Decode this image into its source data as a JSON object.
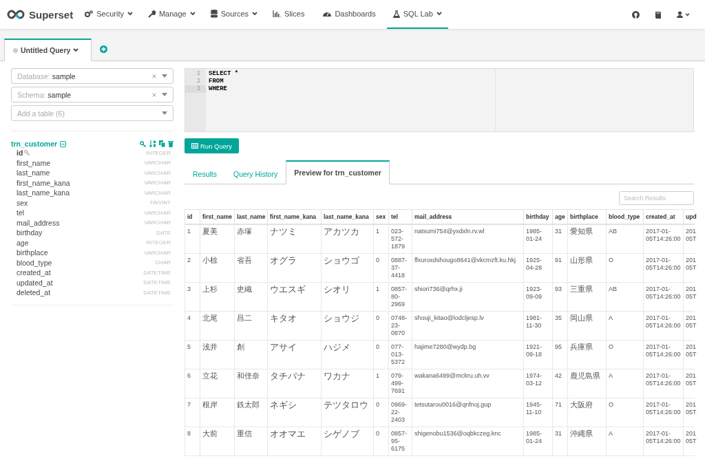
{
  "navbar": {
    "brand": "Superset",
    "items": [
      {
        "label": "Security",
        "dropdown": true,
        "selected": false
      },
      {
        "label": "Manage",
        "dropdown": true,
        "selected": false
      },
      {
        "label": "Sources",
        "dropdown": true,
        "selected": false
      },
      {
        "label": "Slices",
        "dropdown": false,
        "selected": false
      },
      {
        "label": "Dashboards",
        "dropdown": false,
        "selected": false
      },
      {
        "label": "SQL Lab",
        "dropdown": true,
        "selected": true
      }
    ]
  },
  "query_tabs": [
    {
      "label": "Untitled Query",
      "selected": true
    }
  ],
  "sidebar": {
    "database": {
      "label": "Database:",
      "value": "sample"
    },
    "schema": {
      "label": "Schema:",
      "value": "sample"
    },
    "table_select": {
      "placeholder": "Add a table (6)"
    },
    "table": {
      "name": "trn_customer",
      "expanded": true,
      "columns": [
        {
          "name": "id",
          "type": "INTEGER",
          "primary_key": true
        },
        {
          "name": "first_name",
          "type": "VARCHAR",
          "primary_key": false
        },
        {
          "name": "last_name",
          "type": "VARCHAR",
          "primary_key": false
        },
        {
          "name": "first_name_kana",
          "type": "VARCHAR",
          "primary_key": false
        },
        {
          "name": "last_name_kana",
          "type": "VARCHAR",
          "primary_key": false
        },
        {
          "name": "sex",
          "type": "TINYINT",
          "primary_key": false
        },
        {
          "name": "tel",
          "type": "VARCHAR",
          "primary_key": false
        },
        {
          "name": "mail_address",
          "type": "VARCHAR",
          "primary_key": false
        },
        {
          "name": "birthday",
          "type": "DATE",
          "primary_key": false
        },
        {
          "name": "age",
          "type": "INTEGER",
          "primary_key": false
        },
        {
          "name": "birthplace",
          "type": "VARCHAR",
          "primary_key": false
        },
        {
          "name": "blood_type",
          "type": "CHAR",
          "primary_key": false
        },
        {
          "name": "created_at",
          "type": "DATETIME",
          "primary_key": false
        },
        {
          "name": "updated_at",
          "type": "DATETIME",
          "primary_key": false
        },
        {
          "name": "deleted_at",
          "type": "DATETIME",
          "primary_key": false
        }
      ]
    }
  },
  "editor": {
    "lines": [
      {
        "number": "1",
        "text": "SELECT *",
        "active": false
      },
      {
        "number": "2",
        "text": "FROM",
        "active": false
      },
      {
        "number": "3",
        "text": "WHERE",
        "active": true
      }
    ]
  },
  "run_button": "Run Query",
  "result_tabs": [
    {
      "label": "Results",
      "selected": false
    },
    {
      "label": "Query History",
      "selected": false
    },
    {
      "label": "Preview for trn_customer",
      "selected": true
    }
  ],
  "search": {
    "placeholder": "Search Results"
  },
  "table": {
    "columns": [
      "id",
      "first_name",
      "last_name",
      "first_name_kana",
      "last_name_kana",
      "sex",
      "tel",
      "mail_address",
      "birthday",
      "age",
      "birthplace",
      "blood_type",
      "created_at",
      "upd"
    ],
    "rows": [
      [
        "1",
        "夏美",
        "赤塚",
        "ナツミ",
        "アカツカ",
        "1",
        "023-572-1879",
        "natsumi754@yxdxln.rv.wl",
        "1985-01-24",
        "31",
        "愛知県",
        "AB",
        "2017-01-05T14:26:00",
        "201\n05T"
      ],
      [
        "2",
        "小椋",
        "省吾",
        "オグラ",
        "ショウゴ",
        "0",
        "0887-37-4418",
        "ffxuroxdshougo8641@vkcmzft.ku.hkj",
        "1925-04-28",
        "91",
        "山形県",
        "O",
        "2017-01-05T14:26:00",
        "201\n05T"
      ],
      [
        "3",
        "上杉",
        "史織",
        "ウエスギ",
        "シオリ",
        "1",
        "0857-80-2969",
        "shiori736@qrhx.ji",
        "1923-09-09",
        "93",
        "三重県",
        "AB",
        "2017-01-05T14:26:00",
        "201\n05T"
      ],
      [
        "4",
        "北尾",
        "昌二",
        "キタオ",
        "ショウジ",
        "0",
        "0748-23-0870",
        "shouji_kitao@lodcljesp.lv",
        "1981-11-30",
        "35",
        "岡山県",
        "A",
        "2017-01-05T14:26:00",
        "201\n05T"
      ],
      [
        "5",
        "浅井",
        "創",
        "アサイ",
        "ハジメ",
        "0",
        "077-013-5372",
        "hajime7280@wydp.bg",
        "1921-09-18",
        "95",
        "兵庫県",
        "O",
        "2017-01-05T14:26:00",
        "201\n05T"
      ],
      [
        "6",
        "立花",
        "和佳奈",
        "タチバナ",
        "ワカナ",
        "1",
        "079-499-7691",
        "wakana6499@mckru.uh.vv",
        "1974-03-12",
        "42",
        "鹿児島県",
        "A",
        "2017-01-05T14:26:00",
        "201\n05T"
      ],
      [
        "7",
        "根岸",
        "鉄太郎",
        "ネギシ",
        "テツタロウ",
        "0",
        "0969-22-2403",
        "tetsutarou0016@qnfnoj.gup",
        "1945-11-10",
        "71",
        "大阪府",
        "O",
        "2017-01-05T14:26:00",
        "201\n05T"
      ],
      [
        "8",
        "大前",
        "重信",
        "オオマエ",
        "シゲノブ",
        "0",
        "0857-95-6175",
        "shigenobu1536@oqbkczeg.knc",
        "1985-01-24",
        "31",
        "沖縄県",
        "A",
        "2017-01-05T14:26:00",
        "201\n05T"
      ]
    ]
  }
}
